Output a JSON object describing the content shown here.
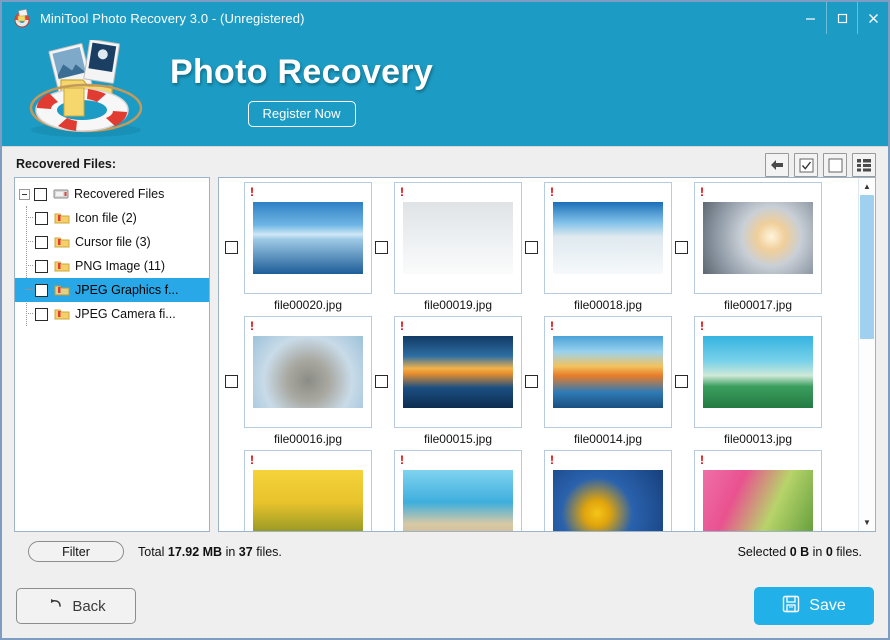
{
  "titlebar": {
    "title": "MiniTool Photo Recovery 3.0 - (Unregistered)",
    "app_icon": "lifebuoy-icon",
    "minimize": "—",
    "maximize": "☐",
    "close": "✕"
  },
  "banner": {
    "heading": "Photo Recovery",
    "register_label": "Register Now",
    "logo_icon": "lifebuoy-photos-logo",
    "background_color": "#1c9cc4"
  },
  "content": {
    "section_label": "Recovered Files:",
    "toolbar": [
      {
        "name": "back-arrow-button",
        "icon": "arrow-left-icon"
      },
      {
        "name": "select-all-button",
        "icon": "checkbox-checked-icon"
      },
      {
        "name": "deselect-all-button",
        "icon": "checkbox-empty-icon"
      },
      {
        "name": "list-view-button",
        "icon": "list-view-icon"
      }
    ]
  },
  "tree": {
    "root": {
      "label": "Recovered Files",
      "icon": "drive-icon",
      "checked": false,
      "expanded": true
    },
    "items": [
      {
        "label": "Icon file (2)",
        "icon": "folder-icon",
        "checked": false,
        "selected": false
      },
      {
        "label": "Cursor file (3)",
        "icon": "folder-icon",
        "checked": false,
        "selected": false
      },
      {
        "label": "PNG Image (11)",
        "icon": "folder-icon",
        "checked": false,
        "selected": false
      },
      {
        "label": "JPEG Graphics f...",
        "icon": "folder-icon",
        "checked": false,
        "selected": true
      },
      {
        "label": "JPEG Camera fi...",
        "icon": "folder-icon",
        "checked": false,
        "selected": false
      }
    ],
    "selection_color": "#29a8e8"
  },
  "thumbnails": {
    "warning_badge": "!",
    "rows": [
      [
        {
          "name": "file00020.jpg",
          "checked": false,
          "image": "frozen-lake-reflection"
        },
        {
          "name": "file00019.jpg",
          "checked": false,
          "image": "snowy-tree-lane-walkers"
        },
        {
          "name": "file00018.jpg",
          "checked": false,
          "image": "sunlit-snow-slope"
        },
        {
          "name": "file00017.jpg",
          "checked": false,
          "image": "winter-sun-halo-city"
        }
      ],
      [
        {
          "name": "file00016.jpg",
          "checked": false,
          "image": "snow-covered-cat"
        },
        {
          "name": "file00015.jpg",
          "checked": false,
          "image": "ocean-sunset"
        },
        {
          "name": "file00014.jpg",
          "checked": false,
          "image": "tropical-beach"
        },
        {
          "name": "file00013.jpg",
          "checked": false,
          "image": "palm-tree-beach"
        }
      ],
      [
        {
          "name": "",
          "checked": false,
          "image": "yellow-flower-field"
        },
        {
          "name": "",
          "checked": false,
          "image": "turquoise-shore"
        },
        {
          "name": "",
          "checked": false,
          "image": "sunflower-blue-sky"
        },
        {
          "name": "",
          "checked": false,
          "image": "pink-blossoms"
        }
      ]
    ],
    "scrollbar": {
      "up_arrow": "▲",
      "down_arrow": "▼",
      "thumb_percent": 45
    }
  },
  "status": {
    "filter_label": "Filter",
    "total_prefix": "Total",
    "total_size": "17.92 MB",
    "total_mid": "in",
    "total_count": "37",
    "total_suffix": "files.",
    "selected_prefix": "Selected",
    "selected_size": "0 B",
    "selected_mid": "in",
    "selected_count": "0",
    "selected_suffix": "files."
  },
  "footer": {
    "back_label": "Back",
    "back_icon": "undo-arrow-icon",
    "save_label": "Save",
    "save_icon": "floppy-disk-icon",
    "save_color": "#22b0e8"
  }
}
